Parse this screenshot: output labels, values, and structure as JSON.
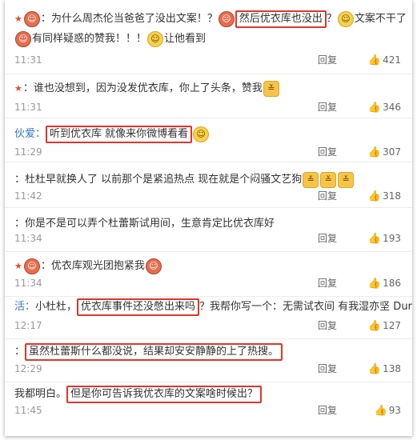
{
  "comments": [
    {
      "t0": "：为什么周杰伦当爸爸了没出文案！？",
      "t1": "然后优衣库也没出",
      "t2": "？",
      "t3": "文案不干了",
      "t4": "有同样疑惑的赞我！！！",
      "t5": "让他看到",
      "time": "11:31",
      "reply": "回复",
      "likes": "421"
    },
    {
      "t0": "：谁也没想到，因为没发优衣库，你上了头条，赞我",
      "time": "11:31",
      "reply": "回复",
      "likes": "346"
    },
    {
      "name": "伙爱：",
      "t1": "听到优衣库 就像来你微博看看",
      "time": "11:29",
      "reply": "回复",
      "likes": "307"
    },
    {
      "t0": "：杜杜早就换人了 以前那个是紧追热点  现在就是个闷骚文艺狗",
      "time": "11:42",
      "reply": "回复",
      "likes": "318"
    },
    {
      "t0": "：你是不是可以弄个杜蕾斯试用间，生意肯定比优衣库好",
      "time": "11:34",
      "reply": "回复",
      "likes": "193"
    },
    {
      "t0": "：优衣库观光团抱紧我",
      "time": "11:34",
      "reply": "回复",
      "likes": "186"
    },
    {
      "name": "活：",
      "t0": "小杜杜，",
      "t1": "优衣库事件还没憋出来吗",
      "t2": "？我帮你写一个：无需试衣间 有我湿亦坚 Durex",
      "time": "12:17",
      "reply": "回复",
      "likes": "127"
    },
    {
      "t0": "：",
      "t1": "虽然杜蕾斯什么都没说，结果却安安静静的上了热搜。",
      "time": "12:29",
      "reply": "回复",
      "likes": "138"
    },
    {
      "t0": "我都明白。",
      "t1": "但是你可告诉我优衣库的文案啥时候出？",
      "time": "11:45",
      "reply": "回复",
      "likes": "93"
    }
  ],
  "icons": {
    "thumb": "thumbs-up-icon",
    "star": "star-icon"
  },
  "colors": {
    "accent_red": "#e0352b",
    "name_orange": "#eb7350",
    "name_blue": "#2f7bbf",
    "meta_gray": "#999999"
  }
}
